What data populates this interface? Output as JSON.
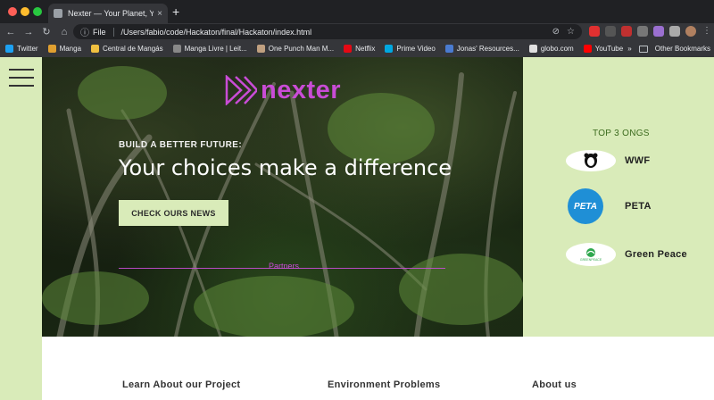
{
  "browser": {
    "tab_title": "Nexter — Your Planet, Your Li",
    "tab_close": "×",
    "new_tab": "+",
    "url_scheme_label": "File",
    "url": "/Users/fabio/code/Hackaton/final/Hackaton/index.html",
    "nav": {
      "back": "←",
      "forward": "→",
      "reload": "↻",
      "home": "⌂"
    },
    "bookmarks": [
      {
        "label": "Twitter",
        "color": "#1da1f2"
      },
      {
        "label": "Manga",
        "color": "#e0a030"
      },
      {
        "label": "Central de Mangás",
        "color": "#f0c040"
      },
      {
        "label": "Manga Livre | Leit...",
        "color": "#888888"
      },
      {
        "label": "One Punch Man M...",
        "color": "#c0a080"
      },
      {
        "label": "Netflix",
        "color": "#e50914"
      },
      {
        "label": "Prime Video",
        "color": "#00a8e1"
      },
      {
        "label": "Jonas' Resources...",
        "color": "#4a7bd0"
      },
      {
        "label": "globo.com",
        "color": "#e0e0e0"
      },
      {
        "label": "YouTube",
        "color": "#ff0000"
      }
    ],
    "bookmarks_overflow": "»",
    "other_bookmarks": "Other Bookmarks"
  },
  "site": {
    "logo_text": "nexter",
    "hero": {
      "subtitle": "BUILD A BETTER FUTURE:",
      "title": "Your choices make a difference",
      "button": "CHECK OURS NEWS",
      "partners": "Partners"
    },
    "ongs": {
      "title": "TOP 3 ONGS",
      "items": [
        {
          "name": "WWF",
          "badge": "WWF"
        },
        {
          "name": "PETA",
          "badge": "PETA"
        },
        {
          "name": "Green Peace",
          "badge": "GREENPEACE"
        }
      ]
    },
    "footer": {
      "col1": "Learn About our Project",
      "col2": "Environment Problems",
      "col3": "About us"
    }
  }
}
